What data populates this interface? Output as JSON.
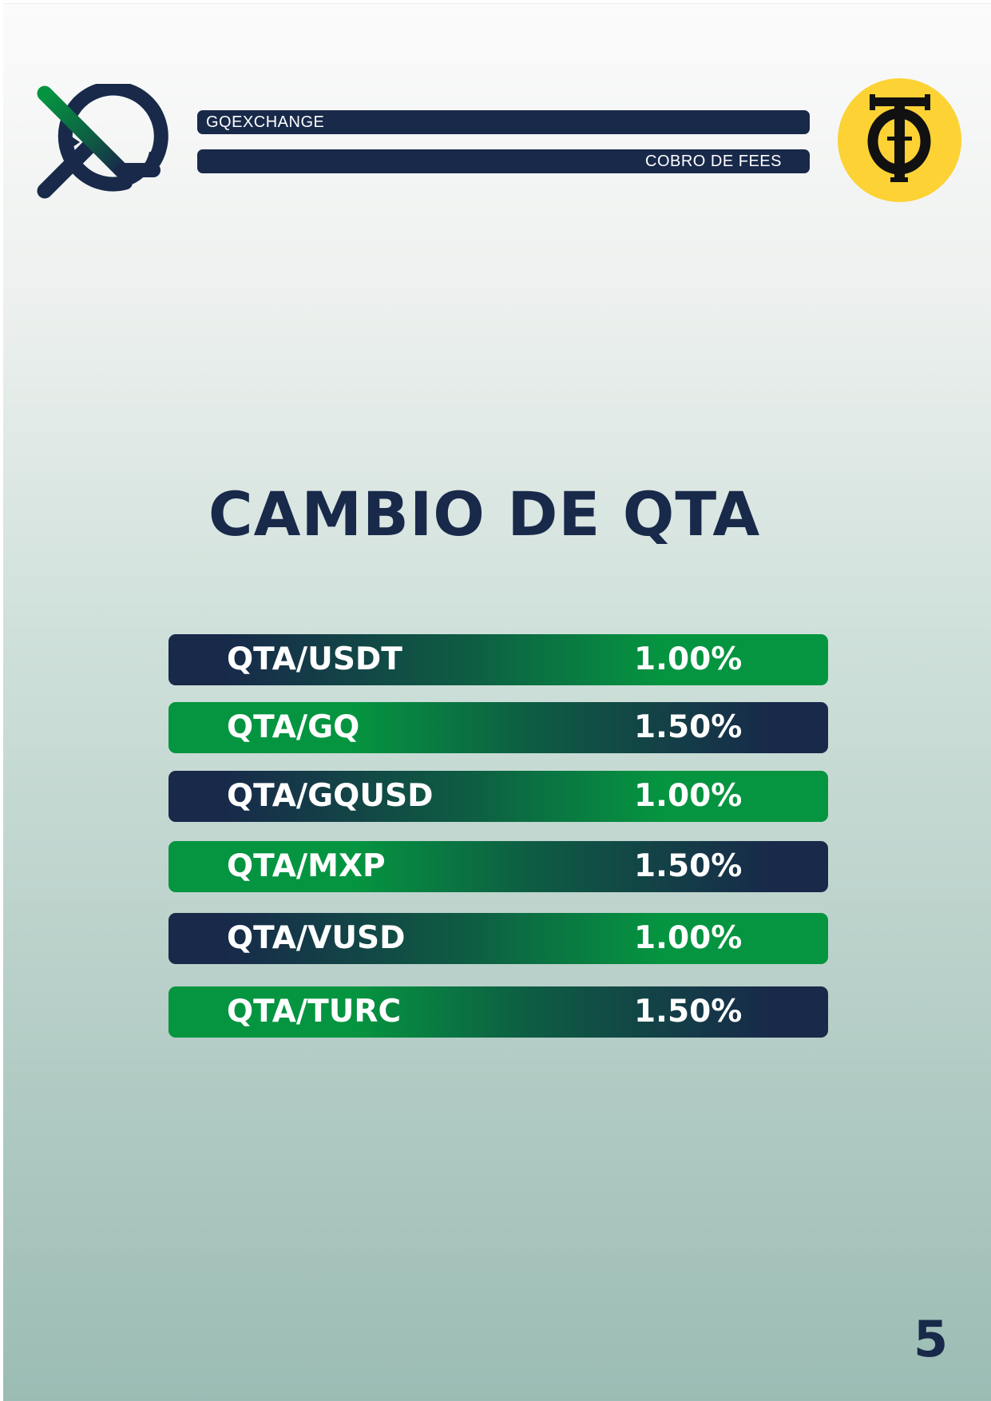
{
  "header": {
    "brand_label": "GQEXCHANGE",
    "section_label": "COBRO DE FEES"
  },
  "logos": {
    "left": "gqexchange-logo",
    "right": "tq-logo"
  },
  "title": "CAMBIO DE QTA",
  "rates": [
    {
      "pair": "QTA/USDT",
      "fee": "1.00%"
    },
    {
      "pair": "QTA/GQ",
      "fee": "1.50%"
    },
    {
      "pair": "QTA/GQUSD",
      "fee": "1.00%"
    },
    {
      "pair": "QTA/MXP",
      "fee": "1.50%"
    },
    {
      "pair": "QTA/VUSD",
      "fee": "1.00%"
    },
    {
      "pair": "QTA/TURC",
      "fee": "1.50%"
    }
  ],
  "page_number": "5",
  "colors": {
    "navy": "#18294a",
    "green": "#059540",
    "gold": "#fcd235"
  }
}
